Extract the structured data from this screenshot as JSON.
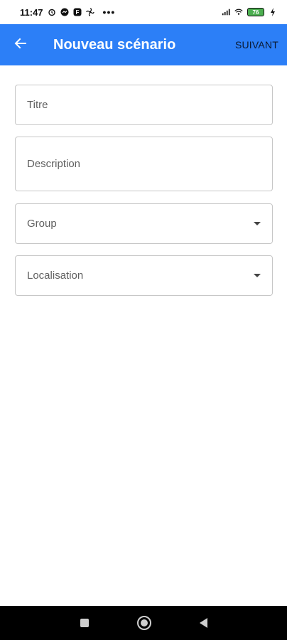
{
  "status_bar": {
    "time": "11:47",
    "dots": "•••",
    "battery_level": "76"
  },
  "app_bar": {
    "title": "Nouveau scénario",
    "next_label": "SUIVANT",
    "back_icon": "arrow-left-icon",
    "color": "#2c7ff7"
  },
  "form": {
    "title_label": "Titre",
    "description_label": "Description",
    "group_label": "Group",
    "localisation_label": "Localisation"
  },
  "nav_bar": {
    "icons": [
      "recent-apps-icon",
      "home-icon",
      "back-icon"
    ]
  }
}
